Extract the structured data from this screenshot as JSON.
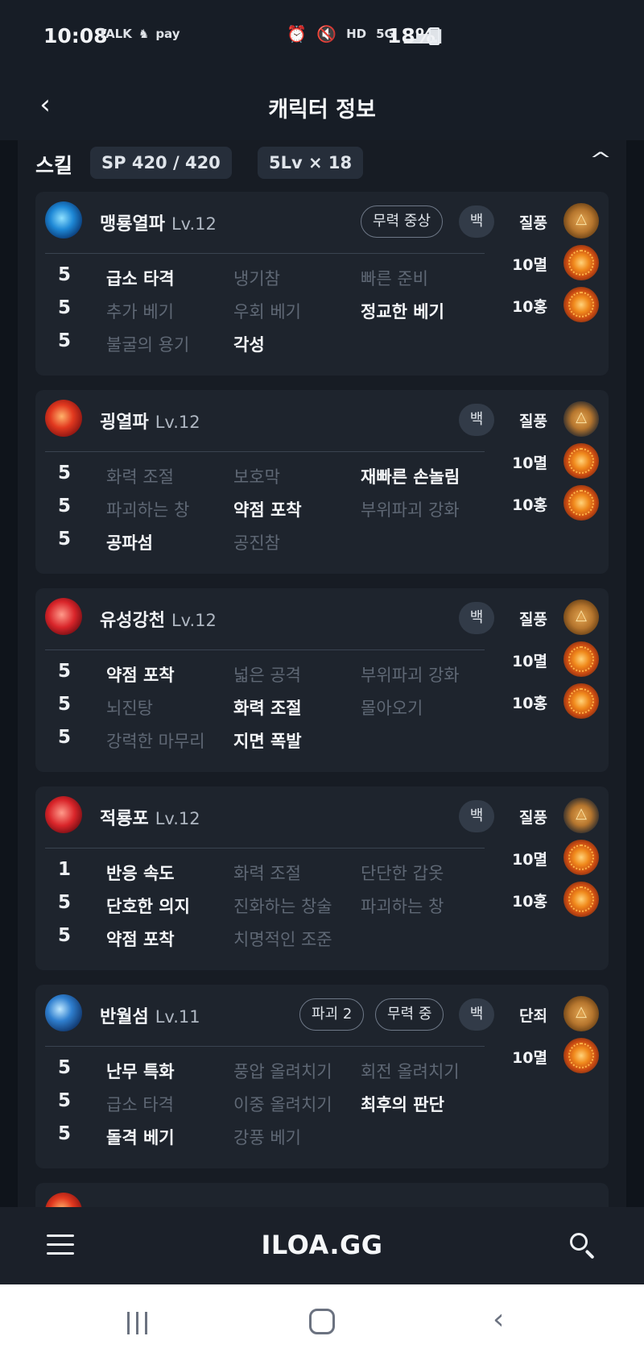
{
  "status": {
    "time": "10:08",
    "left_icons": [
      "TALK",
      "♞",
      "pay"
    ],
    "right_icons": [
      "alarm-icon",
      "mute-icon",
      "HD",
      "5G",
      "signal-icon"
    ],
    "battery": "18%"
  },
  "header": {
    "title": "캐릭터 정보",
    "back_icon": "chevron-left-icon"
  },
  "skills_section": {
    "title": "스킬",
    "sp_chip": "SP 420 / 420",
    "lv_chip": "5Lv × 18",
    "collapse_icon": "chevron-up-icon"
  },
  "cards": [
    {
      "name": "맹룡열파",
      "level": "Lv.12",
      "tags": [
        "무력 중상"
      ],
      "baek": "백",
      "rows": [
        {
          "num": "5",
          "tripods": [
            {
              "label": "급소 타격",
              "on": true
            },
            {
              "label": "냉기참",
              "on": false
            },
            {
              "label": "빠른 준비",
              "on": false
            }
          ]
        },
        {
          "num": "5",
          "tripods": [
            {
              "label": "추가 베기",
              "on": false
            },
            {
              "label": "우회 베기",
              "on": false
            },
            {
              "label": "정교한 베기",
              "on": true
            }
          ]
        },
        {
          "num": "5",
          "tripods": [
            {
              "label": "불굴의 용기",
              "on": false
            },
            {
              "label": "각성",
              "on": true
            }
          ]
        }
      ],
      "gems": [
        {
          "label": "질풍",
          "type": "rune"
        },
        {
          "label": "10멸",
          "type": "fire"
        },
        {
          "label": "10홍",
          "type": "fire"
        }
      ]
    },
    {
      "name": "굉열파",
      "level": "Lv.12",
      "tags": [],
      "baek": "백",
      "rows": [
        {
          "num": "5",
          "tripods": [
            {
              "label": "화력 조절",
              "on": false
            },
            {
              "label": "보호막",
              "on": false
            },
            {
              "label": "재빠른 손놀림",
              "on": true
            }
          ]
        },
        {
          "num": "5",
          "tripods": [
            {
              "label": "파괴하는 창",
              "on": false
            },
            {
              "label": "약점 포착",
              "on": true
            },
            {
              "label": "부위파괴 강화",
              "on": false
            }
          ]
        },
        {
          "num": "5",
          "tripods": [
            {
              "label": "공파섬",
              "on": true
            },
            {
              "label": "공진참",
              "on": false
            }
          ]
        }
      ],
      "gems": [
        {
          "label": "질풍",
          "type": "rune"
        },
        {
          "label": "10멸",
          "type": "fire"
        },
        {
          "label": "10홍",
          "type": "fire"
        }
      ]
    },
    {
      "name": "유성강천",
      "level": "Lv.12",
      "tags": [],
      "baek": "백",
      "rows": [
        {
          "num": "5",
          "tripods": [
            {
              "label": "약점 포착",
              "on": true
            },
            {
              "label": "넓은 공격",
              "on": false
            },
            {
              "label": "부위파괴 강화",
              "on": false
            }
          ]
        },
        {
          "num": "5",
          "tripods": [
            {
              "label": "뇌진탕",
              "on": false
            },
            {
              "label": "화력 조절",
              "on": true
            },
            {
              "label": "몰아오기",
              "on": false
            }
          ]
        },
        {
          "num": "5",
          "tripods": [
            {
              "label": "강력한 마무리",
              "on": false
            },
            {
              "label": "지면 폭발",
              "on": true
            }
          ]
        }
      ],
      "gems": [
        {
          "label": "질풍",
          "type": "rune"
        },
        {
          "label": "10멸",
          "type": "fire"
        },
        {
          "label": "10홍",
          "type": "fire"
        }
      ]
    },
    {
      "name": "적룡포",
      "level": "Lv.12",
      "tags": [],
      "baek": "백",
      "rows": [
        {
          "num": "1",
          "tripods": [
            {
              "label": "반응 속도",
              "on": true
            },
            {
              "label": "화력 조절",
              "on": false
            },
            {
              "label": "단단한 갑옷",
              "on": false
            }
          ]
        },
        {
          "num": "5",
          "tripods": [
            {
              "label": "단호한 의지",
              "on": true
            },
            {
              "label": "진화하는 창술",
              "on": false
            },
            {
              "label": "파괴하는 창",
              "on": false
            }
          ]
        },
        {
          "num": "5",
          "tripods": [
            {
              "label": "약점 포착",
              "on": true
            },
            {
              "label": "치명적인 조준",
              "on": false
            }
          ]
        }
      ],
      "gems": [
        {
          "label": "질풍",
          "type": "rune"
        },
        {
          "label": "10멸",
          "type": "fire"
        },
        {
          "label": "10홍",
          "type": "fire"
        }
      ]
    },
    {
      "name": "반월섬",
      "level": "Lv.11",
      "tags": [
        "파괴 2",
        "무력 중"
      ],
      "baek": "백",
      "rows": [
        {
          "num": "5",
          "tripods": [
            {
              "label": "난무 특화",
              "on": true
            },
            {
              "label": "풍압 올려치기",
              "on": false
            },
            {
              "label": "회전 올려치기",
              "on": false
            }
          ]
        },
        {
          "num": "5",
          "tripods": [
            {
              "label": "급소 타격",
              "on": false
            },
            {
              "label": "이중 올려치기",
              "on": false
            },
            {
              "label": "최후의 판단",
              "on": true
            }
          ]
        },
        {
          "num": "5",
          "tripods": [
            {
              "label": "돌격 베기",
              "on": true
            },
            {
              "label": "강풍 베기",
              "on": false
            }
          ]
        }
      ],
      "gems": [
        {
          "label": "단죄",
          "type": "rune"
        },
        {
          "label": "10멸",
          "type": "fire"
        }
      ]
    }
  ],
  "navbar": {
    "logo": "ILOA.GG",
    "menu_icon": "hamburger-icon",
    "search_icon": "search-icon"
  },
  "system_nav": {
    "recents_icon": "recents-icon",
    "home_icon": "home-icon",
    "back_icon": "back-icon"
  }
}
